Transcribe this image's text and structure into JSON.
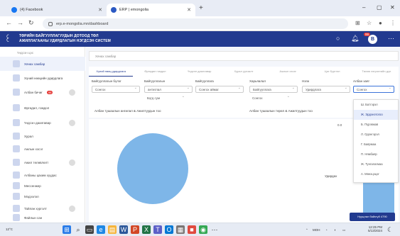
{
  "browser": {
    "tabs": [
      {
        "title": "(4) Facebook",
        "color": "#1877f2"
      },
      {
        "title": "ERP | emongolia",
        "color": "#2b59c3"
      }
    ],
    "new_tab": "+",
    "url": "erp.e-mongolia.mn/dashboard"
  },
  "app": {
    "title_line1": "ТӨРИЙН БАЙГУУЛЛАГУУДЫН ДОТООД ТӨЛ",
    "title_line2": "АЖИЛЛАГААНЫ УДИРДЛАГЫН НЭГДСЭН СИСТЕМ",
    "notification_count": "99",
    "avatar_initial": "В",
    "brand_color": "#223a8f"
  },
  "sidebar": {
    "header": "Үндсэн цэс",
    "items": [
      {
        "label": "Хянах самбар",
        "active": true
      },
      {
        "label": "Хүний нөөцийн удирдлага"
      },
      {
        "label": "Албан бичиг",
        "badge": "99"
      },
      {
        "label": "Өргөдөл, гомдол"
      },
      {
        "label": "Үндсэн даалгавар"
      },
      {
        "label": "Хурал"
      },
      {
        "label": "Ажлын хэсэг"
      },
      {
        "label": "Ажил төлөвлөлт"
      },
      {
        "label": "Албаны цахим хуудас"
      },
      {
        "label": "Мессенжер"
      },
      {
        "label": "Мэдээлэл"
      },
      {
        "label": "Тайлан хүргэлт"
      },
      {
        "label": "Файлын сан"
      }
    ]
  },
  "main": {
    "breadcrumb": "Хянах самбар",
    "tabs": [
      "Хүний нөөц удирдлага",
      "Өргөдөл гомдол",
      "Үндсэн даалгавар",
      "Хурал уулзалт",
      "Ажлын хэсэг",
      "Цаг бүртгэл",
      "Төлөв хэтрэлтийн дүн"
    ],
    "filters": [
      {
        "label": "Байгууллагын бүлэг",
        "value": "Сонгох"
      },
      {
        "label": "Байгууллагын",
        "value": "антиглал",
        "sub": "Бүгд сум"
      },
      {
        "label": "Байгууллага",
        "value": "Сонгох аймаг"
      },
      {
        "label": "Харьяалал",
        "value": "Байгууллага",
        "sub": "Сонгох"
      },
      {
        "label": "Нэгж",
        "value": "Удирдлага"
      },
      {
        "label": "Албан хаяг",
        "value": "Сонгох"
      }
    ],
    "chart_title_left": "Албан тушаалын ангилал & Ажилтуудын тоо",
    "chart_title_right": "Албан тушаалын төрөл & Ажилтуудын тоо"
  },
  "dropdown": {
    "items": [
      "Ш. Батгэрэл",
      "Ж. Эрдэнэтогоо",
      "Б. Пүрэвжав",
      "Л. Одонгэрэл",
      "Г. Баярмаа",
      "П. Нямбаяр",
      "Ж. Тунгалагмаа",
      "А. Мөнхцэцэг"
    ],
    "highlighted_index": 1
  },
  "chart_data": [
    {
      "type": "pie",
      "title": "Албан тушаалын ангилал & Ажилтуудын тоо",
      "slices": [
        {
          "label": "",
          "value": 1
        }
      ],
      "colors": [
        "#7eb6e8"
      ]
    },
    {
      "type": "bar",
      "title": "Албан тушаалын төрөл & Ажилтуудын тоо",
      "orientation": "horizontal",
      "categories": [
        "Удирдах"
      ],
      "values": [
        1
      ],
      "xlim": [
        0,
        1
      ],
      "xticks": [
        "0.0",
        "1"
      ],
      "data_labels": [
        "Удирдах"
      ],
      "color": "#7eb6e8"
    }
  ],
  "toast": "Нууцлал байхгүй 4790",
  "taskbar": {
    "weather": "12°C",
    "lang": "МОН",
    "time": "12:25 PM",
    "date": "5/13/2024"
  }
}
